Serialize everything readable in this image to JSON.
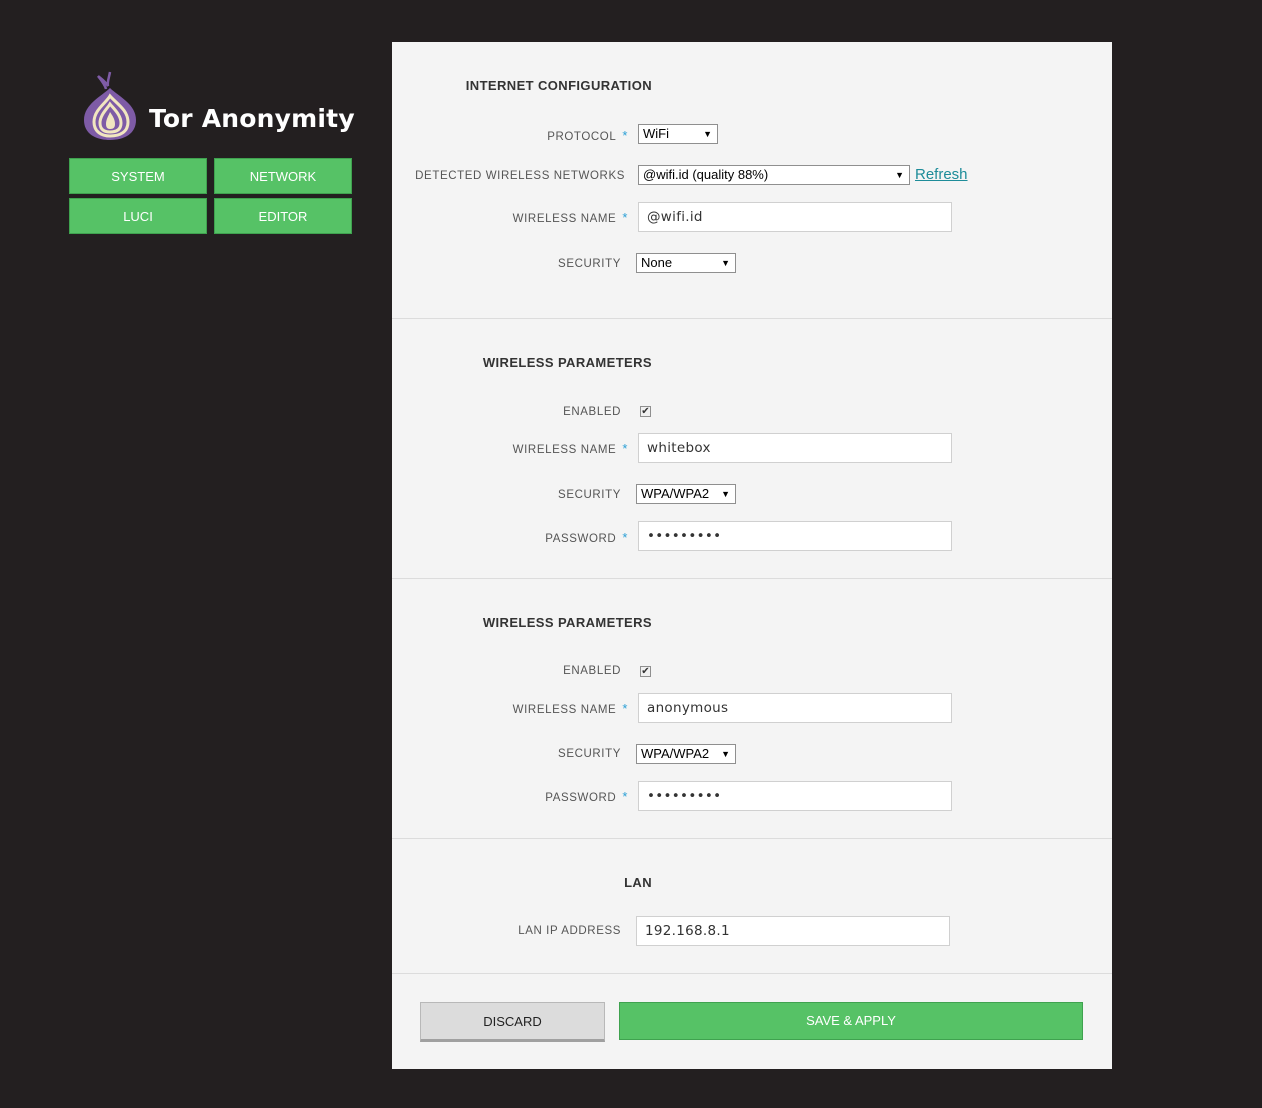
{
  "brand": {
    "title": "Tor Anonymity",
    "logo_icon": "tor-onion-icon"
  },
  "nav": {
    "system": "SYSTEM",
    "network": "NETWORK",
    "luci": "LUCI",
    "editor": "EDITOR"
  },
  "internet": {
    "title": "INTERNET CONFIGURATION",
    "protocol_label": "PROTOCOL",
    "protocol_value": "WiFi",
    "detected_label": "DETECTED WIRELESS NETWORKS",
    "detected_value": "@wifi.id (quality 88%)",
    "refresh_label": "Refresh",
    "wireless_name_label": "WIRELESS NAME",
    "wireless_name_value": "@wifi.id",
    "security_label": "SECURITY",
    "security_value": "None"
  },
  "wireless1": {
    "title": "WIRELESS PARAMETERS",
    "enabled_label": "ENABLED",
    "wireless_name_label": "WIRELESS NAME",
    "wireless_name_value": "whitebox",
    "security_label": "SECURITY",
    "security_value": "WPA/WPA2",
    "password_label": "PASSWORD",
    "password_value": "•••••••••"
  },
  "wireless2": {
    "title": "WIRELESS PARAMETERS",
    "enabled_label": "ENABLED",
    "wireless_name_label": "WIRELESS NAME",
    "wireless_name_value": "anonymous",
    "security_label": "SECURITY",
    "security_value": "WPA/WPA2",
    "password_label": "PASSWORD",
    "password_value": "•••••••••"
  },
  "lan": {
    "title": "LAN",
    "ip_label": "LAN IP ADDRESS",
    "ip_value": "192.168.8.1"
  },
  "actions": {
    "discard": "DISCARD",
    "save": "SAVE & APPLY"
  },
  "required_marker": "*",
  "colors": {
    "background": "#231f20",
    "panel": "#f4f4f4",
    "accent_green": "#56c266",
    "link": "#1d8c99",
    "required": "#2a9fd6"
  }
}
